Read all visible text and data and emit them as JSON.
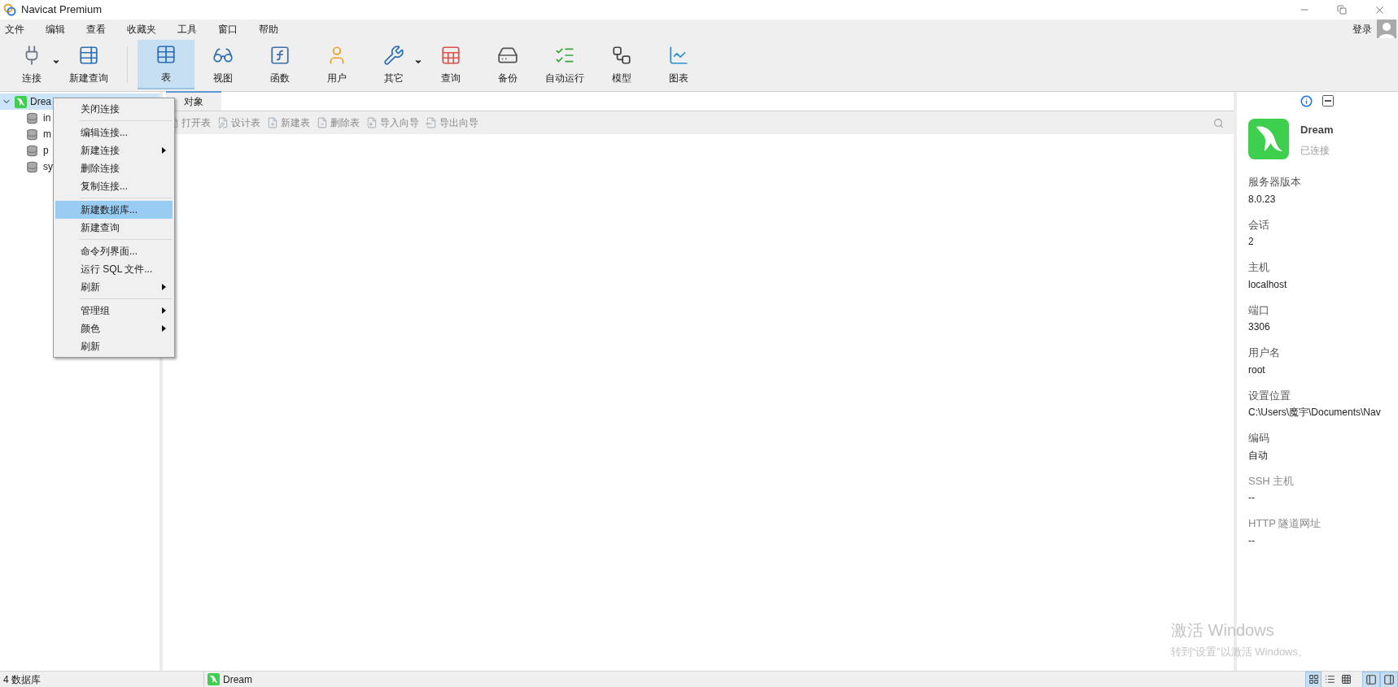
{
  "window": {
    "title": "Navicat Premium"
  },
  "menu_bar": [
    "文件",
    "编辑",
    "查看",
    "收藏夹",
    "工具",
    "窗口",
    "帮助"
  ],
  "login": "登录",
  "toolbar": [
    {
      "label": "连接",
      "selected": false,
      "dropdown": true
    },
    {
      "label": "新建查询",
      "selected": false,
      "dropdown": false
    },
    {
      "label": "表",
      "selected": true,
      "dropdown": false
    },
    {
      "label": "视图",
      "selected": false,
      "dropdown": false
    },
    {
      "label": "函数",
      "selected": false,
      "dropdown": false
    },
    {
      "label": "用户",
      "selected": false,
      "dropdown": false
    },
    {
      "label": "其它",
      "selected": false,
      "dropdown": true
    },
    {
      "label": "查询",
      "selected": false,
      "dropdown": false
    },
    {
      "label": "备份",
      "selected": false,
      "dropdown": false
    },
    {
      "label": "自动运行",
      "selected": false,
      "dropdown": false
    },
    {
      "label": "模型",
      "selected": false,
      "dropdown": false
    },
    {
      "label": "图表",
      "selected": false,
      "dropdown": false
    }
  ],
  "tree": [
    {
      "label": "Drea",
      "expanded": true,
      "selected": true,
      "children": [
        {
          "label": "in",
          "selected": false
        },
        {
          "label": "m",
          "selected": false
        },
        {
          "label": "p",
          "selected": false
        },
        {
          "label": "sy",
          "selected": false
        }
      ]
    }
  ],
  "context_menu": {
    "groups": [
      [
        {
          "label": "关闭连接",
          "submenu": false,
          "selected": false
        }
      ],
      [
        {
          "label": "编辑连接...",
          "submenu": false,
          "selected": false
        },
        {
          "label": "新建连接",
          "submenu": true,
          "selected": false
        },
        {
          "label": "删除连接",
          "submenu": false,
          "selected": false
        },
        {
          "label": "复制连接...",
          "submenu": false,
          "selected": false
        }
      ],
      [
        {
          "label": "新建数据库...",
          "submenu": false,
          "selected": true
        },
        {
          "label": "新建查询",
          "submenu": false,
          "selected": false
        }
      ],
      [
        {
          "label": "命令列界面...",
          "submenu": false,
          "selected": false
        },
        {
          "label": "运行 SQL 文件...",
          "submenu": false,
          "selected": false
        },
        {
          "label": "刷新",
          "submenu": true,
          "selected": false
        }
      ],
      [
        {
          "label": "管理组",
          "submenu": true,
          "selected": false
        },
        {
          "label": "颜色",
          "submenu": true,
          "selected": false
        },
        {
          "label": "刷新",
          "submenu": false,
          "selected": false
        }
      ]
    ]
  },
  "tabs": [
    {
      "label": "对象",
      "selected": true
    }
  ],
  "object_toolbar": [
    {
      "label": "打开表",
      "disabled": true
    },
    {
      "label": "设计表",
      "disabled": true
    },
    {
      "label": "新建表",
      "disabled": true
    },
    {
      "label": "删除表",
      "disabled": true
    },
    {
      "label": "导入向导",
      "disabled": true
    },
    {
      "label": "导出向导",
      "disabled": true
    }
  ],
  "info_panel": {
    "name": "Dream",
    "status": "已连接",
    "fields": [
      {
        "label": "服务器版本",
        "value": "8.0.23",
        "muted": false
      },
      {
        "label": "会话",
        "value": "2",
        "muted": false
      },
      {
        "label": "主机",
        "value": "localhost",
        "muted": false
      },
      {
        "label": "端口",
        "value": "3306",
        "muted": false
      },
      {
        "label": "用户名",
        "value": "root",
        "muted": false
      },
      {
        "label": "设置位置",
        "value": "C:\\Users\\魔宇\\Documents\\Nav",
        "muted": false
      },
      {
        "label": "编码",
        "value": "自动",
        "muted": false
      },
      {
        "label": "SSH 主机",
        "value": "--",
        "muted": true
      },
      {
        "label": "HTTP 隧道网址",
        "value": "--",
        "muted": true
      }
    ]
  },
  "activation_notice": {
    "title": "激活 Windows",
    "text": "转到“设置”以激活 Windows。"
  },
  "status_bar": {
    "left": "4 数据库",
    "connection": "Dream",
    "view_buttons": [
      {
        "selected": true
      },
      {
        "selected": false
      },
      {
        "selected": false
      }
    ],
    "panel_buttons": [
      {
        "selected": true
      },
      {
        "selected": true
      }
    ]
  }
}
